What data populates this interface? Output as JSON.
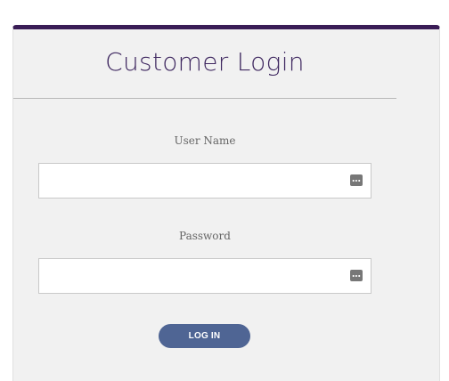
{
  "login": {
    "title": "Customer Login",
    "username_label": "User Name",
    "username_value": "",
    "password_label": "Password",
    "password_value": "",
    "submit_label": "LOG IN",
    "field_icon": "key-dots-icon"
  },
  "colors": {
    "accent_top_border": "#3a1d56",
    "title_text": "#3f2860",
    "button_bg": "#4f6594",
    "card_bg": "#f1f1f1"
  }
}
